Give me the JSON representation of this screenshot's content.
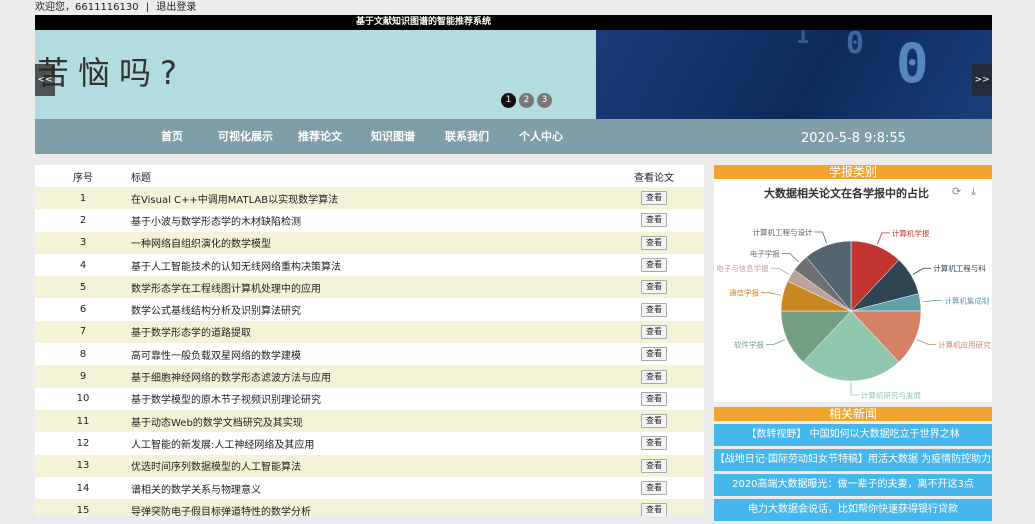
{
  "top": {
    "welcome": "欢迎您，6611116130",
    "sep": "|",
    "logout": "退出登录"
  },
  "title": "基于文献知识图谱的智能推荐系统",
  "banner": {
    "text": "苦恼吗?",
    "prev": "<<",
    "next": ">>",
    "dots": [
      "1",
      "2",
      "3"
    ],
    "active_dot": "1"
  },
  "nav": {
    "items": [
      "首页",
      "可视化展示",
      "推荐论文",
      "知识图谱",
      "联系我们",
      "个人中心"
    ],
    "datetime": "2020-5-8 9:8:55"
  },
  "table": {
    "headers": [
      "序号",
      "标题",
      "查看论文"
    ],
    "button_label": "查看",
    "rows": [
      {
        "no": "1",
        "title": "在Visual C++中调用MATLAB以实现数学算法"
      },
      {
        "no": "2",
        "title": "基于小波与数学形态学的木材缺陷检测"
      },
      {
        "no": "3",
        "title": "一种网络自组织演化的数学模型"
      },
      {
        "no": "4",
        "title": "基于人工智能技术的认知无线网络重构决策算法"
      },
      {
        "no": "5",
        "title": "数学形态学在工程线图计算机处理中的应用"
      },
      {
        "no": "6",
        "title": "数学公式基线结构分析及识别算法研究"
      },
      {
        "no": "7",
        "title": "基于数学形态学的道路提取"
      },
      {
        "no": "8",
        "title": "高可靠性一般负载双星网络的数学建模"
      },
      {
        "no": "9",
        "title": "基于细胞神经网络的数学形态滤波方法与应用"
      },
      {
        "no": "10",
        "title": "基于数学模型的原木节子视频识别理论研究"
      },
      {
        "no": "11",
        "title": "基于动态Web的数学文档研究及其实现"
      },
      {
        "no": "12",
        "title": "人工智能的新发展:人工神经网络及其应用"
      },
      {
        "no": "13",
        "title": "优选时间序列数据模型的人工智能算法"
      },
      {
        "no": "14",
        "title": "谱相关的数学关系与物理意义"
      },
      {
        "no": "15",
        "title": "导弹突防电子假目标弹道特性的数学分析"
      }
    ]
  },
  "journal": {
    "header": "学报类别",
    "refresh_icon": "refresh-icon",
    "download_icon": "download-icon"
  },
  "chart_data": {
    "type": "pie",
    "title": "大数据相关论文在各学报中的占比",
    "slices": [
      {
        "label": "计算机学报",
        "value": 12,
        "color": "#c23531"
      },
      {
        "label": "计算机工程与科",
        "value": 9,
        "color": "#2f4554"
      },
      {
        "label": "计算机集成制",
        "value": 4,
        "color": "#61a0a8"
      },
      {
        "label": "计算机应用研究",
        "value": 13,
        "color": "#d48265"
      },
      {
        "label": "计算机研究与发展",
        "value": 24,
        "color": "#91c7ae"
      },
      {
        "label": "软件学报",
        "value": 13,
        "color": "#749f83"
      },
      {
        "label": "通信学报",
        "value": 7,
        "color": "#ca8622"
      },
      {
        "label": "电子与信息学报",
        "value": 3,
        "color": "#bda29a"
      },
      {
        "label": "电子学报",
        "value": 4,
        "color": "#6e7074"
      },
      {
        "label": "计算机工程与设计",
        "value": 11,
        "color": "#546570"
      }
    ]
  },
  "news": {
    "header": "相关新闻",
    "items": [
      "【数转视野】 中国如何以大数据吃立于世界之林",
      "【战地日记·国际劳动妇女节特稿】用活大数据 为疫情防控助力",
      "2020高端大数据曝光：做一辈子的夫妻，离不开这3点",
      "电力大数据会说话，比如帮你快速获得银行贷款"
    ]
  }
}
